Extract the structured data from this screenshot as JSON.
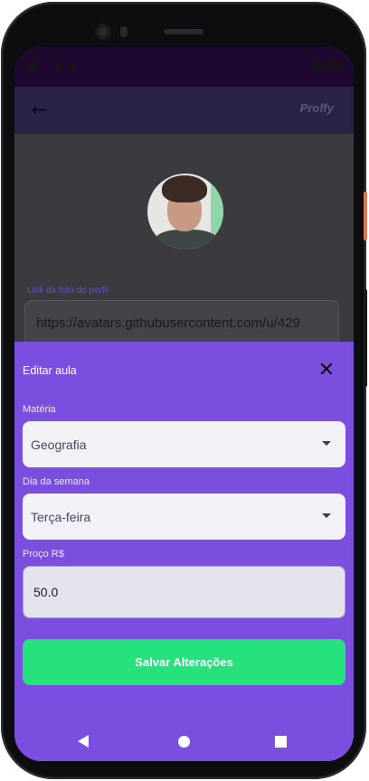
{
  "app": {
    "brand": "Proffy"
  },
  "profile": {
    "photo_link_label": "Link da foto de perfil",
    "photo_link_value": "https://avatars.githubusercontent.com/u/429"
  },
  "sheet": {
    "title": "Editar aula",
    "subject_label": "Matéria",
    "subject_value": "Geografia",
    "weekday_label": "Dia da semana",
    "weekday_value": "Terça-feira",
    "price_label": "Proço R$",
    "price_value": "50.0",
    "save_label": "Salvar Alterações"
  },
  "icons": {
    "back": "arrow-left-icon",
    "close": "close-icon",
    "dropdown": "chevron-down-icon"
  },
  "colors": {
    "sheet": "#7a4fe0",
    "save_button": "#25e27d",
    "appbar": "#2a2247"
  }
}
